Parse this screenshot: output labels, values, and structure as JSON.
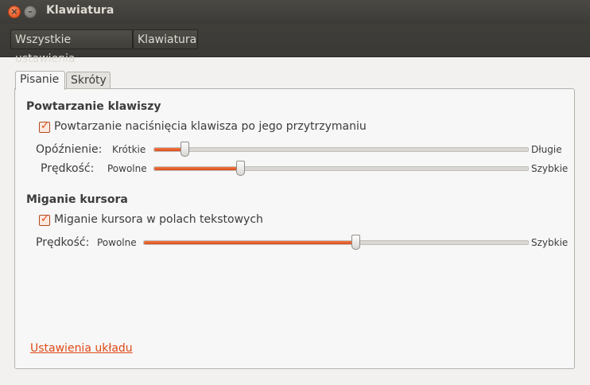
{
  "window": {
    "title": "Klawiatura"
  },
  "breadcrumb": {
    "items": [
      "Wszystkie ustawienia",
      "Klawiatura"
    ]
  },
  "tabs": [
    {
      "label": "Pisanie",
      "active": true
    },
    {
      "label": "Skróty",
      "active": false
    }
  ],
  "repeat": {
    "heading": "Powtarzanie klawiszy",
    "checkbox_label": "Powtarzanie naciśnięcia klawisza po jego przytrzymaniu",
    "checked": true,
    "delay": {
      "label": "Opóźnienie:",
      "min_label": "Krótkie",
      "max_label": "Długie",
      "value": 0.08
    },
    "speed": {
      "label": "Prędkość:",
      "min_label": "Powolne",
      "max_label": "Szybkie",
      "value": 0.23
    }
  },
  "cursor": {
    "heading": "Miganie kursora",
    "checkbox_label": "Miganie kursora w polach tekstowych",
    "checked": true,
    "speed": {
      "label": "Prędkość:",
      "min_label": "Powolne",
      "max_label": "Szybkie",
      "value": 0.55
    }
  },
  "layout_link": "Ustawienia układu",
  "colors": {
    "accent": "#df4a16",
    "titlebar": "#3c3b37"
  }
}
